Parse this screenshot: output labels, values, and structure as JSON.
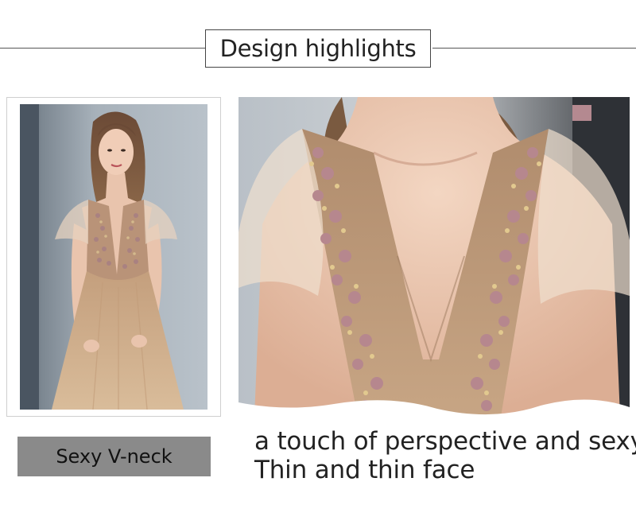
{
  "header": {
    "title": "Design highlights"
  },
  "feature": {
    "badge_label": "Sexy V-neck",
    "caption_line1": "a touch of perspective and sexy",
    "caption_line2": "Thin and thin face"
  },
  "colors": {
    "badge_bg": "#8a8a8a",
    "dress_champagne": "#c9a987",
    "embroidery_mauve": "#b88f95",
    "backdrop_gray": "#9aa4ad"
  }
}
